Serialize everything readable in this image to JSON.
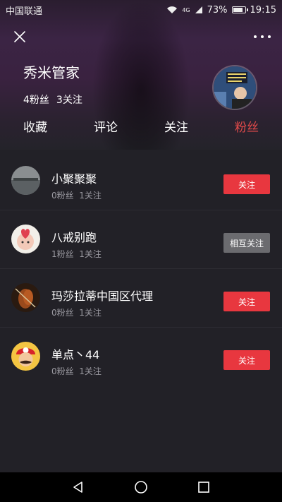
{
  "status": {
    "carrier": "中国联通",
    "signal": "4G",
    "battery": "73%",
    "battery_level": 0.73,
    "time": "19:15"
  },
  "profile": {
    "name": "秀米管家",
    "fans": "4粉丝",
    "follows": "3关注"
  },
  "tabs": [
    {
      "label": "收藏"
    },
    {
      "label": "评论"
    },
    {
      "label": "关注"
    },
    {
      "label": "粉丝",
      "active": true
    }
  ],
  "followers": [
    {
      "name": "小聚聚聚",
      "fans": "0粉丝",
      "follows": "1关注",
      "button": "关注"
    },
    {
      "name": "八戒别跑",
      "fans": "1粉丝",
      "follows": "1关注",
      "button": "相互关注"
    },
    {
      "name": "玛莎拉蒂中国区代理",
      "fans": "0粉丝",
      "follows": "1关注",
      "button": "关注"
    },
    {
      "name": "单点丶44",
      "fans": "0粉丝",
      "follows": "1关注",
      "button": "关注"
    }
  ],
  "colors": {
    "accent": "#e24a4a",
    "follow_button": "#e8373f",
    "mutual_button": "#6b6b6f",
    "background": "#222127"
  },
  "icons": {
    "close": "close-icon",
    "more": "more-icon",
    "back": "back-icon",
    "home": "home-icon",
    "recents": "recents-icon"
  }
}
